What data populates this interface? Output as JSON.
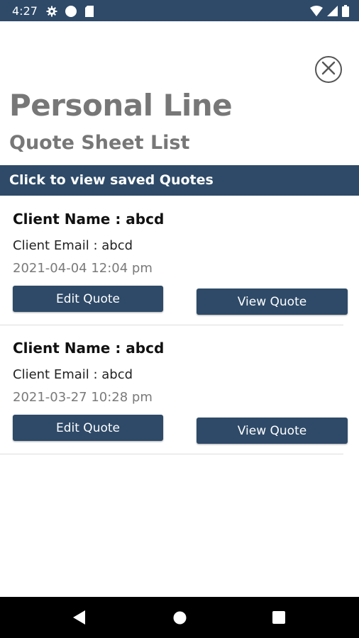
{
  "status_bar": {
    "time": "4:27",
    "left_icons": [
      "gear-icon",
      "circle-icon",
      "sd-card-icon"
    ],
    "right_icons": [
      "wifi-icon",
      "signal-icon",
      "battery-icon"
    ],
    "color": "#2e4a68"
  },
  "header": {
    "title": "Personal Line",
    "subtitle": "Quote Sheet List",
    "close_icon": "close-circle-icon"
  },
  "banner": {
    "label": "Click to view saved Quotes",
    "color": "#2e4a68"
  },
  "quotes": [
    {
      "client_name": "Client Name : abcd",
      "client_email": "Client Email : abcd",
      "date": "2021-04-04 12:04 pm",
      "edit_label": "Edit Quote",
      "view_label": "View Quote"
    },
    {
      "client_name": "Client Name : abcd",
      "client_email": "Client Email : abcd",
      "date": "2021-03-27 10:28 pm",
      "edit_label": "Edit Quote",
      "view_label": "View Quote"
    }
  ],
  "nav_bar": {
    "icons": [
      "back-triangle-icon",
      "home-circle-icon",
      "recents-square-icon"
    ]
  }
}
